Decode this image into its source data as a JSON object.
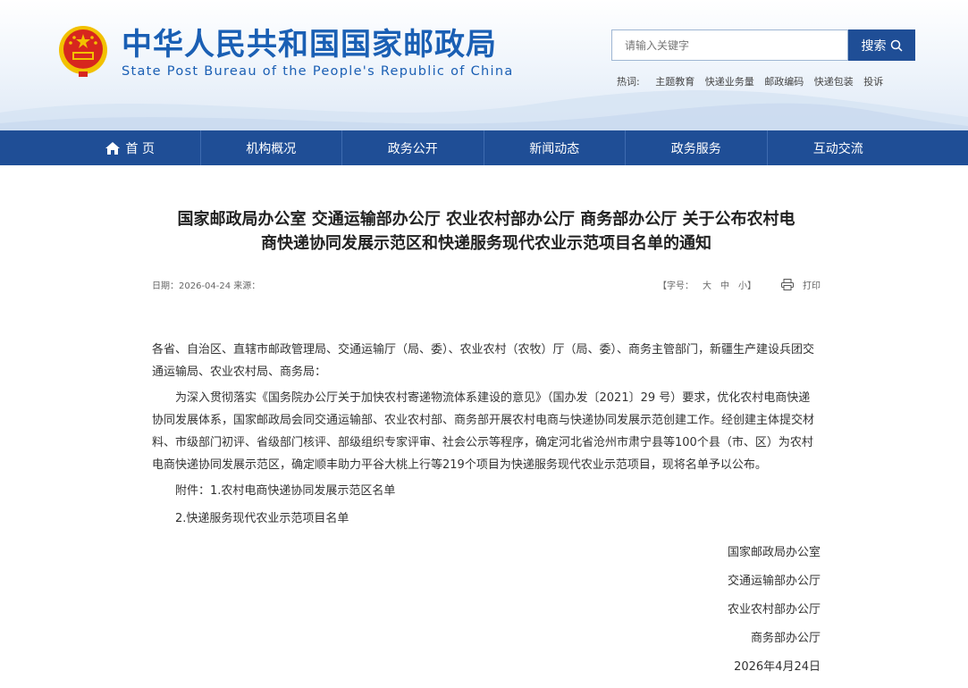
{
  "header": {
    "title_cn": "中华人民共和国国家邮政局",
    "title_en": "State Post Bureau of the People's Republic of China",
    "emblem_icon": "national-emblem-icon",
    "search_placeholder": "请输入关键字",
    "search_button": "搜索",
    "hot_label": "热词:",
    "hot_words": [
      "主题教育",
      "快递业务量",
      "邮政编码",
      "快递包装",
      "投诉"
    ]
  },
  "nav": {
    "items": [
      "首 页",
      "机构概况",
      "政务公开",
      "新闻动态",
      "政务服务",
      "互动交流"
    ],
    "home_icon": "home-icon"
  },
  "article": {
    "title_line1": "国家邮政局办公室 交通运输部办公厅 农业农村部办公厅 商务部办公厅 关于公布农村电",
    "title_line2": "商快递协同发展示范区和快递服务现代农业示范项目名单的通知",
    "date": "日期：2026-04-24 来源：",
    "font_label": "【字号：",
    "font_large": "大",
    "font_medium": "中",
    "font_small": "小】",
    "print_label": "打印",
    "salutation": "各省、自治区、直辖市邮政管理局、交通运输厅（局、委）、农业农村（农牧）厅（局、委）、商务主管部门，新疆生产建设兵团交通运输局、农业农村局、商务局：",
    "paragraph": "为深入贯彻落实《国务院办公厅关于加快农村寄递物流体系建设的意见》（国办发〔2021〕29 号）要求，优化农村电商快递协同发展体系，国家邮政局会同交通运输部、农业农村部、商务部开展农村电商与快递协同发展示范创建工作。经创建主体提交材料、市级部门初评、省级部门核评、部级组织专家评审、社会公示等程序，确定河北省沧州市肃宁县等100个县（市、区）为农村电商快递协同发展示范区，确定顺丰助力平谷大桃上行等219个项目为快递服务现代农业示范项目，现将名单予以公布。",
    "attachment1": "附件：1.农村电商快递协同发展示范区名单",
    "attachment2": "2.快递服务现代农业示范项目名单",
    "signers": [
      "国家邮政局办公室",
      "交通运输部办公厅",
      "农业农村部办公厅",
      "商务部办公厅"
    ],
    "sign_date": "2026年4月24日"
  },
  "colors": {
    "brand_blue": "#1f4e96",
    "title_blue": "#1a5fb4",
    "emblem_red": "#d7261e",
    "emblem_gold": "#f2c100"
  }
}
